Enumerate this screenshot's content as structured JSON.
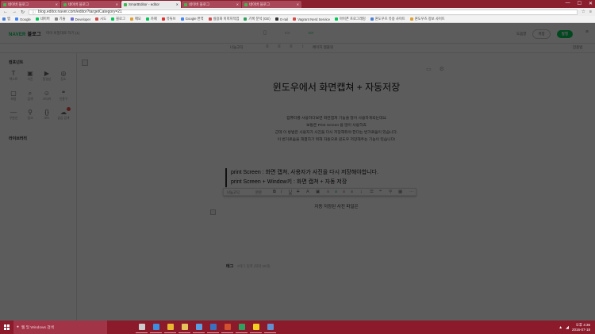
{
  "browser": {
    "tabs": [
      {
        "label": "네이버 블로그"
      },
      {
        "label": "네이버 블로그"
      },
      {
        "label": "SmartEditor - editor",
        "active": true
      },
      {
        "label": "네이버 블로그"
      },
      {
        "label": "네이버 블로그"
      }
    ],
    "window_controls": {
      "minimize": "—",
      "maximize": "☐",
      "close": "✕"
    },
    "nav": {
      "back": "←",
      "forward": "→",
      "reload": "↻"
    },
    "url": "blog.editor.naver.com/editor?targetCategory=21",
    "bookmarks": [
      {
        "label": "앱",
        "color": "#4a7fd6"
      },
      {
        "label": "Google",
        "color": "#4285f4"
      },
      {
        "label": "네이버",
        "color": "#03c75a"
      },
      {
        "label": "기술",
        "color": "#888888"
      },
      {
        "label": "Developer",
        "color": "#6a6ad0"
      },
      {
        "label": "시도",
        "color": "#d24b4b"
      },
      {
        "label": "블로그",
        "color": "#03c75a"
      },
      {
        "label": "메모",
        "color": "#e0a030"
      },
      {
        "label": "카페",
        "color": "#03c75a"
      },
      {
        "label": "유튜브",
        "color": "#e03030"
      },
      {
        "label": "Google 번역",
        "color": "#4285f4"
      },
      {
        "label": "실용화 이미지작업",
        "color": "#d24b4b"
      },
      {
        "label": "기록 분석 (GE)",
        "color": "#30a060"
      },
      {
        "label": "G-rail",
        "color": "#333333"
      },
      {
        "label": "Vagrant Nerd Service",
        "color": "#d24b4b"
      },
      {
        "label": "아이폰 프로그래밍",
        "color": "#03c75a"
      },
      {
        "label": "윈도우즈 유용 사이트",
        "color": "#4a7fd6"
      },
      {
        "label": "윈도우즈 정보 사이트",
        "color": "#e0a030"
      }
    ]
  },
  "editor": {
    "brand": "NAVER",
    "brand_sub": "블로그",
    "blog_name": "마이 비밀대로 하기 (1)",
    "header_links": {
      "help": "도움말"
    },
    "buttons": {
      "save": "저장",
      "publish": "발행"
    },
    "format_bar": {
      "font": "나눔고딕",
      "size": "15",
      "quote_style": "인용구 스타일",
      "page_style": "페이지 템플릿"
    },
    "right_label": "맞춤법"
  },
  "components": {
    "title": "컴포넌트",
    "items": [
      {
        "label": "텍스트",
        "icon": "T"
      },
      {
        "label": "사진",
        "icon": "▣"
      },
      {
        "label": "동영상",
        "icon": "▶"
      },
      {
        "label": "장소",
        "icon": "◎"
      },
      {
        "label": "파일",
        "icon": "▢"
      },
      {
        "label": "검색",
        "icon": "⌕"
      },
      {
        "label": "스티커",
        "icon": "☺"
      },
      {
        "label": "인용구",
        "icon": "❝"
      },
      {
        "label": "구분선",
        "icon": "—"
      },
      {
        "label": "링크",
        "icon": "⚲"
      },
      {
        "label": "코드",
        "icon": "{}"
      },
      {
        "label": "글감 검색",
        "icon": "☁",
        "badge": true
      }
    ],
    "library_title": "라이브러리"
  },
  "document": {
    "title": "윈도우에서 화면캡쳐 + 자동저장",
    "intro_lines": [
      "컴퓨터를 사용하다보면 화면캡쳐 기능을 많이 사용하게되는데요",
      "보통은 Print Screen 을 많이 사용하죠",
      "근데 이 방법은 사용자가 사진을 다시 저장해줘야 한다는 번거로움이 있습니다.",
      "이 번거로움을 해결하기 위해 자동으로 윈도우 저장해주는 기능이 있습니다!"
    ],
    "quote_lines": [
      "print Screen : 화면 캡쳐, 사용자가 사진을 다시 저장해야합니다.",
      "print Screen + Window키 : 화면 캡쳐 + 자동 저장"
    ],
    "context_toolbar": {
      "font": "나눔고딕",
      "size": "본문",
      "bold": "B",
      "italic": "I",
      "underline": "U",
      "strike": "T"
    },
    "image_caption": "자동 저장된 사진 파일은",
    "tag_label": "태그",
    "tag_placeholder": "#태그 입력 (최대 30개)"
  },
  "taskbar": {
    "search_placeholder": "웹 및 Windows 검색",
    "apps": [
      {
        "name": "task-view",
        "color": "#cccccc"
      },
      {
        "name": "edge",
        "color": "#3a8fe0"
      },
      {
        "name": "chrome",
        "color": "#e8b830"
      },
      {
        "name": "explorer",
        "color": "#e6c25a"
      },
      {
        "name": "store",
        "color": "#5aa0e0"
      },
      {
        "name": "word",
        "color": "#3a70c0"
      },
      {
        "name": "powerpoint",
        "color": "#d05030"
      },
      {
        "name": "excel",
        "color": "#30a060"
      },
      {
        "name": "kakao",
        "color": "#f0d020"
      },
      {
        "name": "photos",
        "color": "#6090d0"
      }
    ],
    "time": "오후 4:36",
    "date": "2016-07-18"
  }
}
